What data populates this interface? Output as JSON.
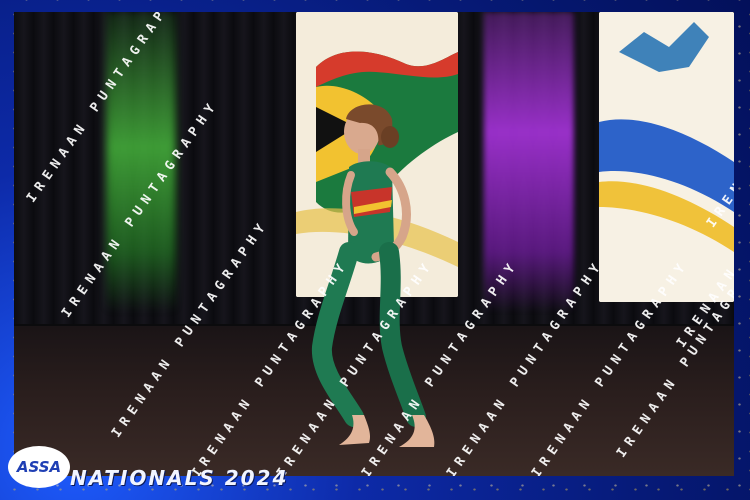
{
  "event": {
    "logo_text": "ASSA",
    "title": "NATIONALS 2024"
  },
  "watermark": {
    "text": "IRENAAN PUNTAGRAPHY"
  },
  "colors": {
    "frame_blue": "#0d2aa8",
    "spot_green": "#3cae3a",
    "spot_purple": "#9b30c8",
    "leotard_green": "#1f7a52",
    "leotard_red": "#c8342a"
  }
}
